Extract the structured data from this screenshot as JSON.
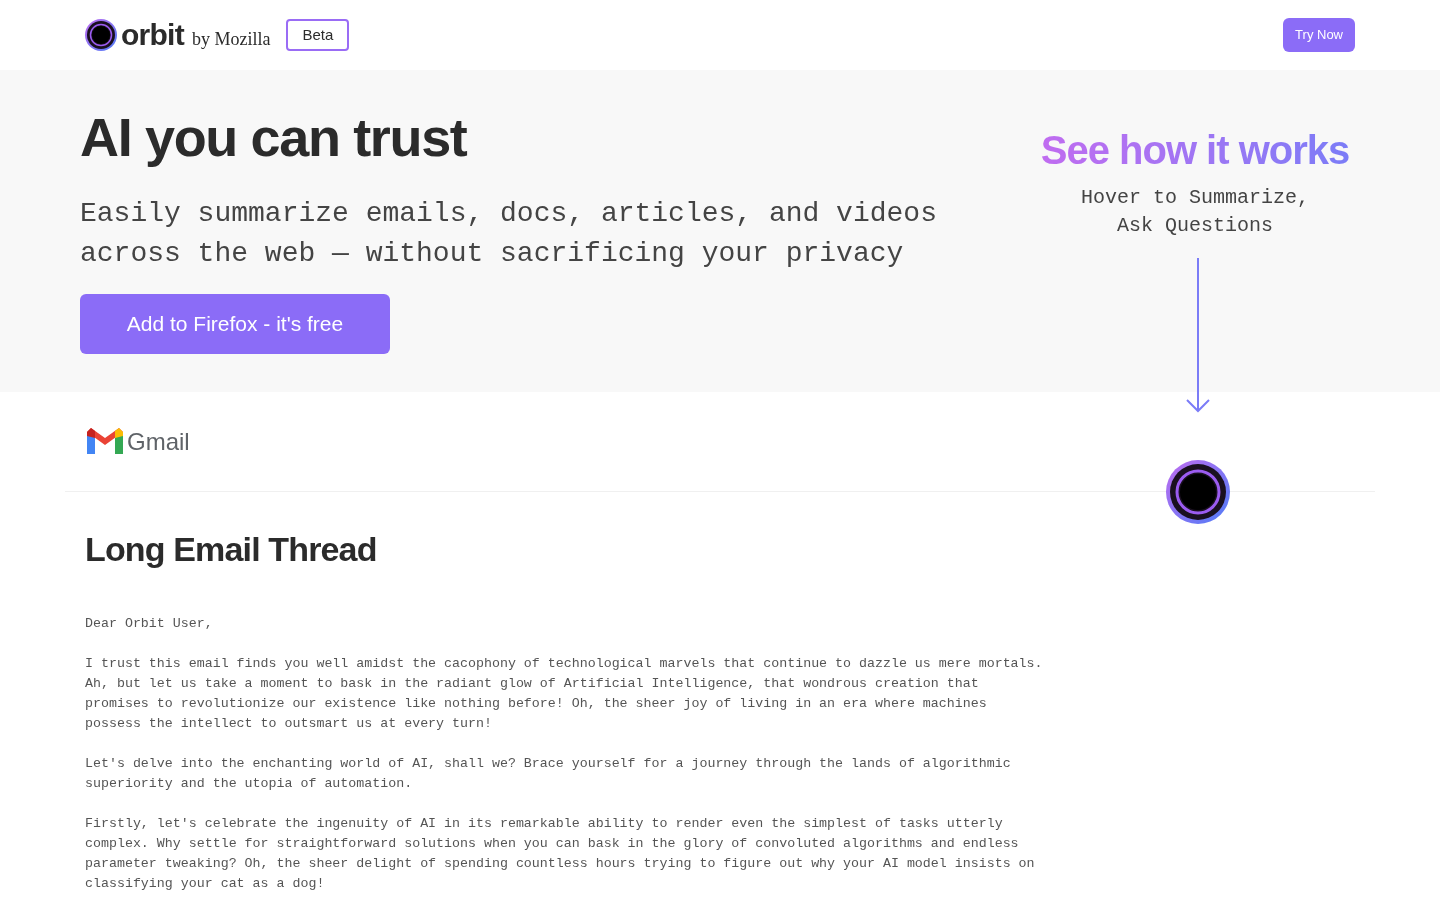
{
  "header": {
    "logo_word": "orbit",
    "logo_byline": "by Mozilla",
    "badge": "Beta",
    "cta": "Try Now"
  },
  "hero": {
    "title": "AI you can trust",
    "subtitle_lines": [
      "Easily summarize emails, docs, articles, and videos",
      "across the web — without sacrificing your privacy"
    ],
    "button": "Add to Firefox - it's free"
  },
  "how_it_works": {
    "title": "See how it works",
    "lines": [
      "Hover to Summarize,",
      "Ask Questions"
    ]
  },
  "email": {
    "app": "Gmail",
    "title": "Long Email Thread",
    "paragraphs": [
      [
        "Dear Orbit User,"
      ],
      [
        "I trust this email finds you well amidst the cacophony of technological marvels that continue to dazzle us mere mortals.",
        "Ah, but let us take a moment to bask in the radiant glow of Artificial Intelligence, that wondrous creation that",
        "promises to revolutionize our existence like nothing before! Oh, the sheer joy of living in an era where machines",
        "possess the intellect to outsmart us at every turn!"
      ],
      [
        "Let's delve into the enchanting world of AI, shall we? Brace yourself for a journey through the lands of algorithmic",
        "superiority and the utopia of automation."
      ],
      [
        "Firstly, let's celebrate the ingenuity of AI in its remarkable ability to render even the simplest of tasks utterly",
        "complex. Why settle for straightforward solutions when you can bask in the glory of convoluted algorithms and endless",
        "parameter tweaking? Oh, the sheer delight of spending countless hours trying to figure out why your AI model insists on",
        "classifying your cat as a dog!"
      ]
    ]
  }
}
